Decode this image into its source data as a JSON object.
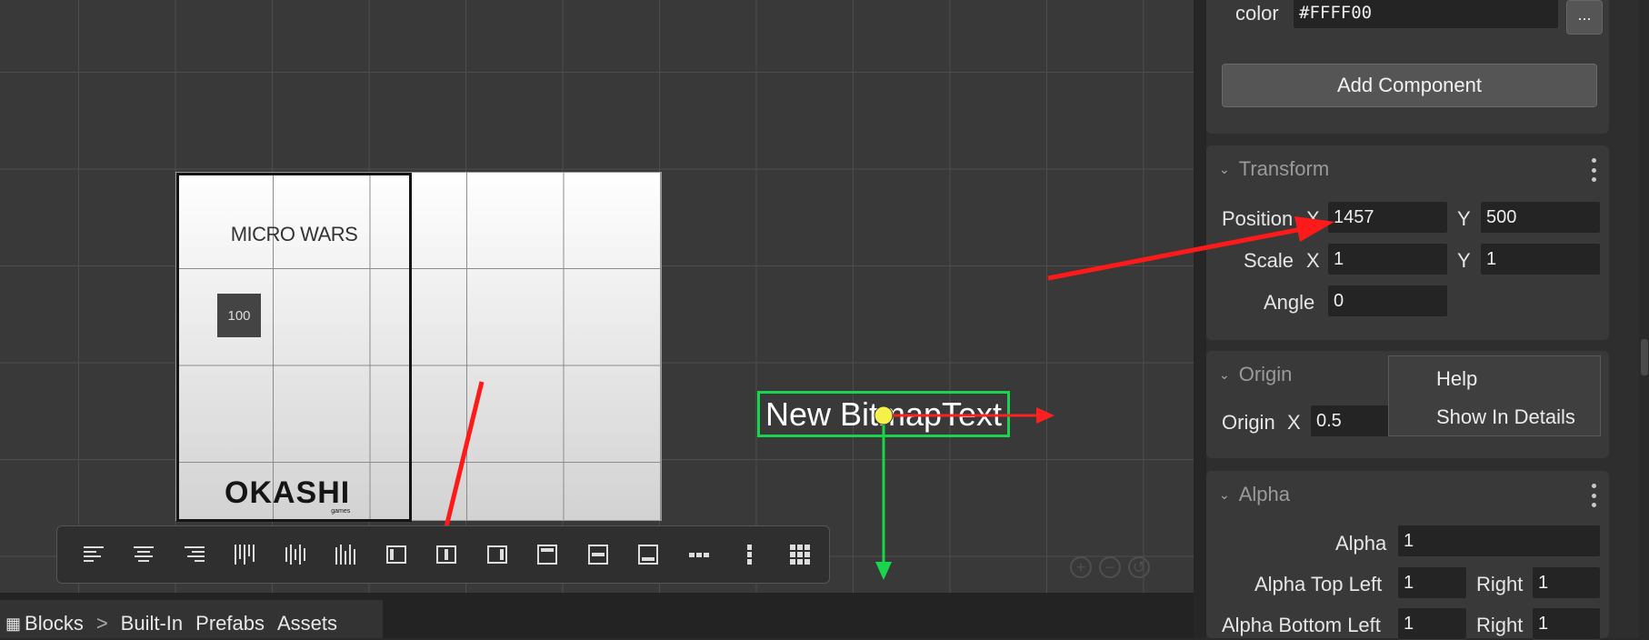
{
  "scene": {
    "game_title": "MICRO WARS",
    "score_value": "100",
    "logo_text": "OKASHI",
    "logo_subtext": "games",
    "bitmap_text": "New BitmapText"
  },
  "toolbar": {
    "buttons": [
      {
        "name": "align-left-icon"
      },
      {
        "name": "align-center-icon"
      },
      {
        "name": "align-right-icon"
      },
      {
        "name": "distribute-left-icon"
      },
      {
        "name": "distribute-center-icon"
      },
      {
        "name": "distribute-right-icon"
      },
      {
        "name": "align-border-left-icon"
      },
      {
        "name": "align-border-center-icon"
      },
      {
        "name": "align-border-right-icon"
      },
      {
        "name": "align-border-top-icon"
      },
      {
        "name": "align-border-middle-icon"
      },
      {
        "name": "align-border-bottom-icon"
      },
      {
        "name": "distribute-horizontal-icon"
      },
      {
        "name": "distribute-vertical-icon"
      },
      {
        "name": "grid-layout-icon"
      }
    ]
  },
  "zoom": {
    "in": "+",
    "out": "−",
    "reset": "↺"
  },
  "blocks_bar": {
    "blocks": "Blocks",
    "separator": ">",
    "built_in": "Built-In",
    "prefabs": "Prefabs",
    "assets": "Assets"
  },
  "inspector": {
    "color_label": "color",
    "color_value": "#FFFF00",
    "color_more": "...",
    "add_component": "Add Component",
    "transform": {
      "title": "Transform",
      "position_label": "Position",
      "x_label": "X",
      "y_label": "Y",
      "position_x": "1457",
      "position_y": "500",
      "scale_label": "Scale",
      "scale_x": "1",
      "scale_y": "1",
      "angle_label": "Angle",
      "angle": "0"
    },
    "origin": {
      "title": "Origin",
      "origin_label": "Origin",
      "x_label": "X",
      "origin_x": "0.5"
    },
    "context_menu": {
      "help": "Help",
      "show_in_details": "Show In Details"
    },
    "alpha": {
      "title": "Alpha",
      "alpha_label": "Alpha",
      "alpha": "1",
      "top_left_label": "Alpha Top Left",
      "top_left": "1",
      "right_label": "Right",
      "top_right": "1",
      "bottom_left_label": "Alpha Bottom Left",
      "bottom_left": "1",
      "bottom_right": "1"
    }
  },
  "colors": {
    "gizmo_x_axis": "#ff2020",
    "gizmo_y_axis": "#19d44d",
    "gizmo_origin": "#f5f04a",
    "annotation_arrow": "#ff1a1a"
  }
}
